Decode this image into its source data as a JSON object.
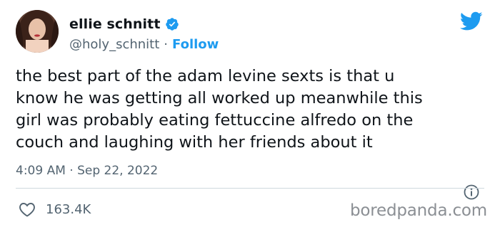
{
  "author": {
    "display_name": "ellie schnitt",
    "handle": "@holy_schnitt",
    "separator": "·",
    "follow_label": "Follow"
  },
  "tweet": {
    "text": "the best part of the adam levine sexts is that u\nknow he was getting all worked up meanwhile this\ngirl was probably eating fettuccine alfredo on the\ncouch and laughing with her friends about it",
    "timestamp": "4:09 AM · Sep 22, 2022"
  },
  "engagement": {
    "likes": "163.4K"
  },
  "watermark": "boredpanda.com",
  "icons": {
    "verified": "verified-badge-icon",
    "brand": "twitter-bird-icon",
    "info": "info-icon",
    "like": "heart-icon"
  },
  "colors": {
    "twitter_blue": "#1d9bf0",
    "text_primary": "#0f1419",
    "text_secondary": "#536471",
    "divider": "#cfd9de"
  }
}
